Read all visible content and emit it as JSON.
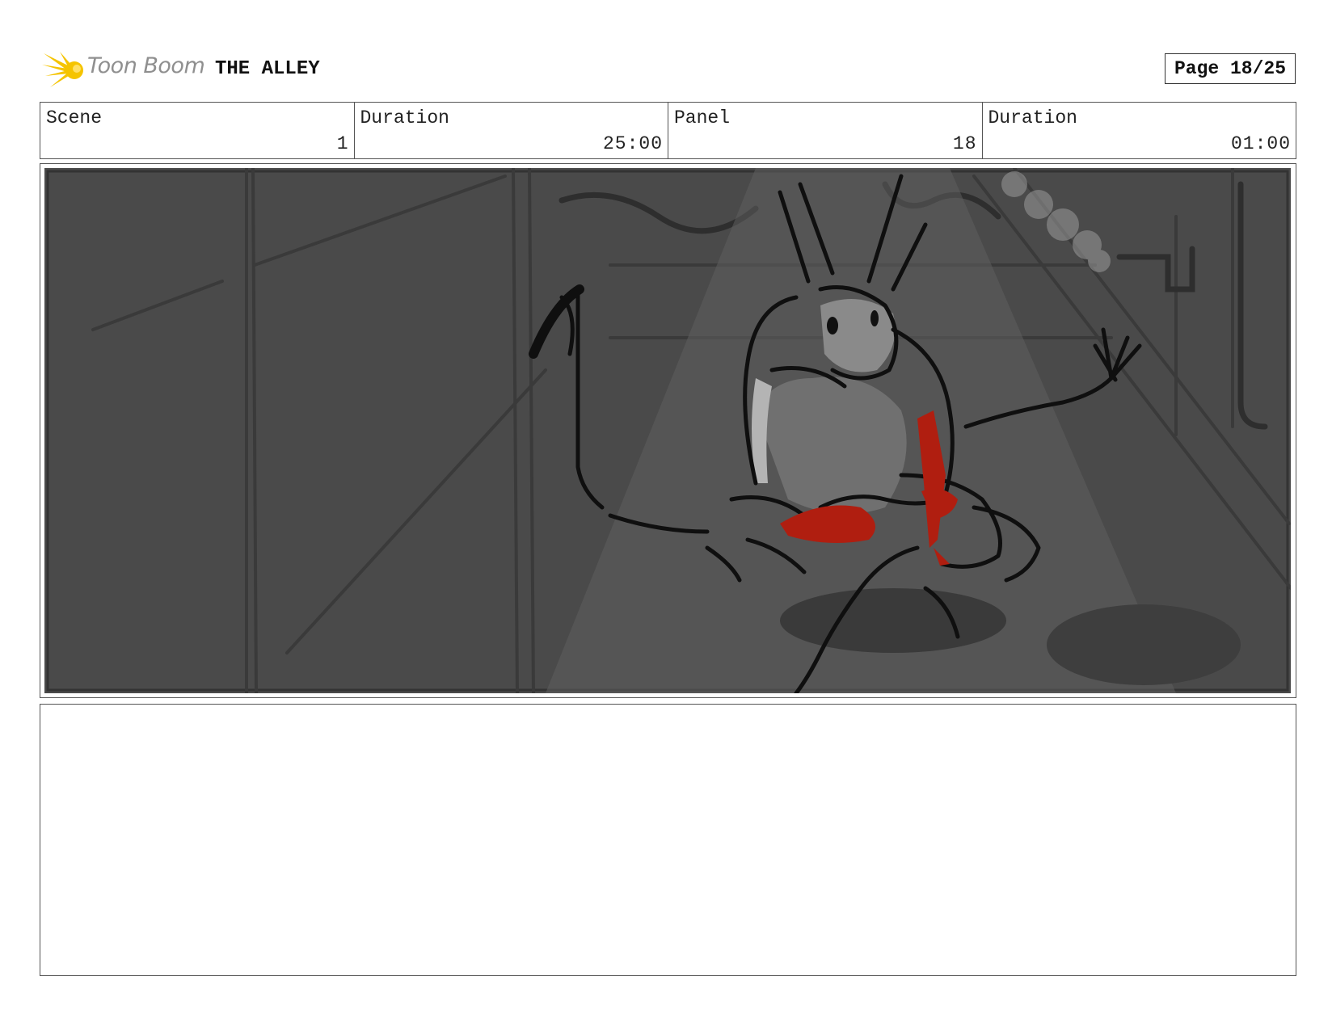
{
  "header": {
    "logo_text": "Toon Boom",
    "project_title": "THE ALLEY",
    "page_label": "Page 18/25"
  },
  "info": {
    "scene_label": "Scene",
    "scene_value": "1",
    "scene_duration_label": "Duration",
    "scene_duration_value": "25:00",
    "panel_label": "Panel",
    "panel_value": "18",
    "panel_duration_label": "Duration",
    "panel_duration_value": "01:00"
  },
  "colors": {
    "logo_yellow": "#f5c400",
    "blood_red": "#b01e10",
    "panel_bg": "#4a4a4a"
  },
  "notes": {
    "text": ""
  }
}
